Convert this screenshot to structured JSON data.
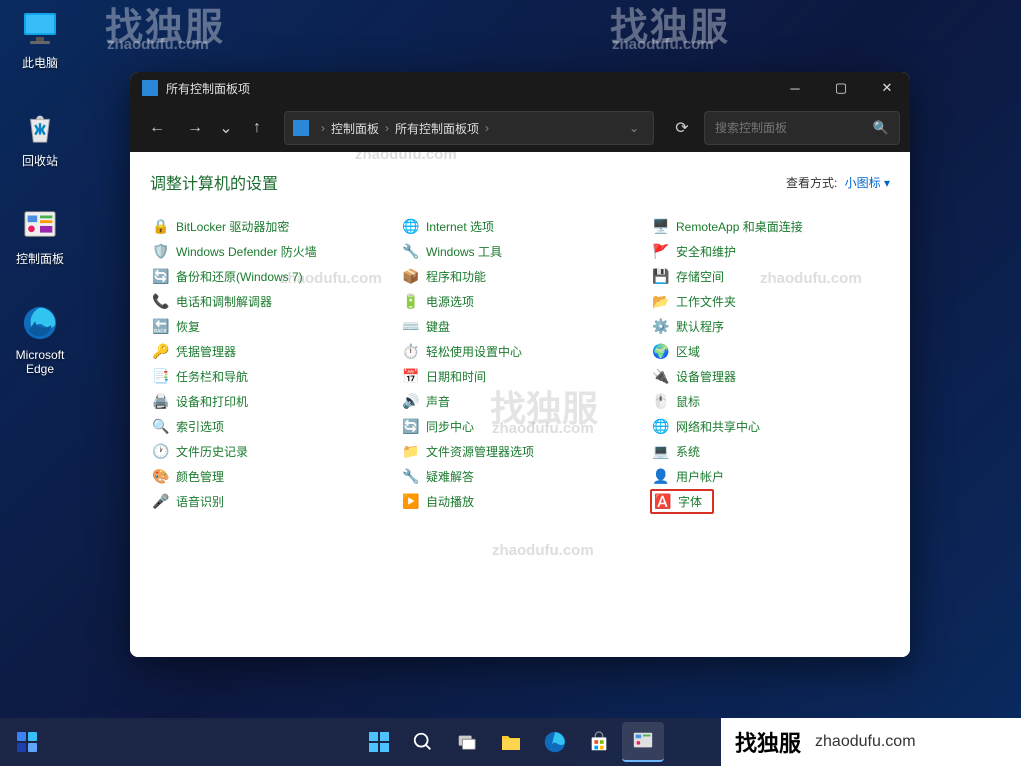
{
  "desktop": {
    "icons": [
      {
        "name": "此电脑"
      },
      {
        "name": "回收站"
      },
      {
        "name": "控制面板"
      },
      {
        "name": "Microsoft Edge"
      }
    ]
  },
  "watermarks": {
    "big": "找独服",
    "small": "zhaodufu.com"
  },
  "window": {
    "title": "所有控制面板项",
    "breadcrumb": {
      "root": "控制面板",
      "current": "所有控制面板项"
    },
    "search_placeholder": "搜索控制面板",
    "heading": "调整计算机的设置",
    "viewby_label": "查看方式:",
    "viewby_value": "小图标",
    "columns": [
      [
        {
          "label": "BitLocker 驱动器加密",
          "icon": "🔒"
        },
        {
          "label": "Windows Defender 防火墙",
          "icon": "🛡️"
        },
        {
          "label": "备份和还原(Windows 7)",
          "icon": "🔄"
        },
        {
          "label": "电话和调制解调器",
          "icon": "📞"
        },
        {
          "label": "恢复",
          "icon": "🔙"
        },
        {
          "label": "凭据管理器",
          "icon": "🔑"
        },
        {
          "label": "任务栏和导航",
          "icon": "📑"
        },
        {
          "label": "设备和打印机",
          "icon": "🖨️"
        },
        {
          "label": "索引选项",
          "icon": "🔍"
        },
        {
          "label": "文件历史记录",
          "icon": "🕐"
        },
        {
          "label": "颜色管理",
          "icon": "🎨"
        },
        {
          "label": "语音识别",
          "icon": "🎤"
        }
      ],
      [
        {
          "label": "Internet 选项",
          "icon": "🌐"
        },
        {
          "label": "Windows 工具",
          "icon": "🔧"
        },
        {
          "label": "程序和功能",
          "icon": "📦"
        },
        {
          "label": "电源选项",
          "icon": "🔋"
        },
        {
          "label": "键盘",
          "icon": "⌨️"
        },
        {
          "label": "轻松使用设置中心",
          "icon": "⏱️"
        },
        {
          "label": "日期和时间",
          "icon": "📅"
        },
        {
          "label": "声音",
          "icon": "🔊"
        },
        {
          "label": "同步中心",
          "icon": "🔄"
        },
        {
          "label": "文件资源管理器选项",
          "icon": "📁"
        },
        {
          "label": "疑难解答",
          "icon": "🔧"
        },
        {
          "label": "自动播放",
          "icon": "▶️"
        }
      ],
      [
        {
          "label": "RemoteApp 和桌面连接",
          "icon": "🖥️"
        },
        {
          "label": "安全和维护",
          "icon": "🚩"
        },
        {
          "label": "存储空间",
          "icon": "💾"
        },
        {
          "label": "工作文件夹",
          "icon": "📂"
        },
        {
          "label": "默认程序",
          "icon": "⚙️"
        },
        {
          "label": "区域",
          "icon": "🌍"
        },
        {
          "label": "设备管理器",
          "icon": "🔌"
        },
        {
          "label": "鼠标",
          "icon": "🖱️"
        },
        {
          "label": "网络和共享中心",
          "icon": "🌐"
        },
        {
          "label": "系统",
          "icon": "💻"
        },
        {
          "label": "用户帐户",
          "icon": "👤"
        },
        {
          "label": "字体",
          "icon": "🅰️",
          "highlight": true
        }
      ]
    ]
  },
  "corner": {
    "big": "找独服",
    "small": "zhaodufu.com"
  }
}
